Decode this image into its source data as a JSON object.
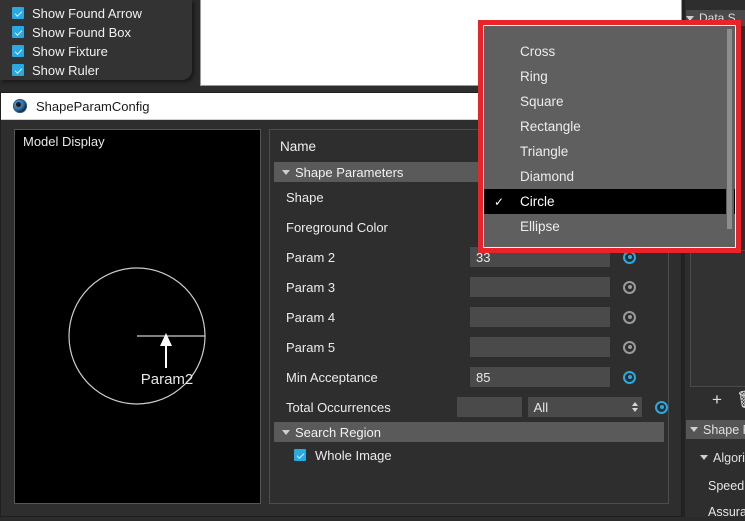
{
  "visibility_popup": {
    "items": [
      {
        "label": "Show Found Arrow",
        "checked": true
      },
      {
        "label": "Show Found Box",
        "checked": true
      },
      {
        "label": "Show Fixture",
        "checked": true
      },
      {
        "label": "Show Ruler",
        "checked": true
      }
    ]
  },
  "dialog": {
    "title": "ShapeParamConfig",
    "model_display": {
      "label": "Model Display",
      "annotation": "Param2"
    },
    "params": {
      "name_header": "Name",
      "section_shape": "Shape Parameters",
      "rows": [
        {
          "label": "Shape",
          "value": "",
          "radio": "none"
        },
        {
          "label": "Foreground Color",
          "value": "",
          "radio": "none"
        },
        {
          "label": "Param 2",
          "value": "33",
          "radio": "on"
        },
        {
          "label": "Param 3",
          "value": "",
          "radio": "off"
        },
        {
          "label": "Param 4",
          "value": "",
          "radio": "off"
        },
        {
          "label": "Param 5",
          "value": "",
          "radio": "off"
        },
        {
          "label": "Min Acceptance",
          "value": "85",
          "radio": "on"
        }
      ],
      "total_occurrences": {
        "label": "Total Occurrences",
        "count_value": "",
        "mode_value": "All",
        "radio": "on"
      },
      "section_search": "Search Region",
      "whole_image": {
        "label": "Whole Image",
        "checked": true
      }
    }
  },
  "shape_dropdown": {
    "options": [
      {
        "label": "Cross",
        "selected": false
      },
      {
        "label": "Ring",
        "selected": false
      },
      {
        "label": "Square",
        "selected": false
      },
      {
        "label": "Rectangle",
        "selected": false
      },
      {
        "label": "Triangle",
        "selected": false
      },
      {
        "label": "Diamond",
        "selected": false
      },
      {
        "label": "Circle",
        "selected": true
      },
      {
        "label": "Ellipse",
        "selected": false
      }
    ],
    "checkmark": "✓",
    "highlight_color": "#e8242a"
  },
  "right_panel": {
    "data_section": "Data S",
    "toolbar": {
      "add": "+",
      "delete": "🗑"
    },
    "sections": [
      {
        "label": "Shape P"
      },
      {
        "label": "Algori"
      }
    ],
    "items": [
      {
        "label": "Speed"
      },
      {
        "label": "Assura"
      }
    ]
  }
}
